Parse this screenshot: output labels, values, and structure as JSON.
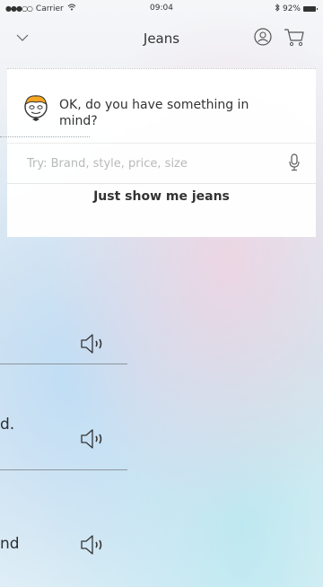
{
  "status_bar": {
    "signal": "●●●○○",
    "carrier": "Carrier",
    "time": "09:04",
    "battery_text": "92%"
  },
  "header": {
    "title": "Jeans",
    "back_icon": "chevron-down-icon",
    "profile_icon": "avatar-icon",
    "cart_icon": "cart-icon"
  },
  "chat": {
    "bot_message": "OK, do you have something in mind?",
    "search_placeholder": "Try: Brand, style, price, size",
    "just_show_label": "Just show me jeans"
  },
  "background_messages": [
    {
      "text": "",
      "icon": "speaker-icon"
    },
    {
      "text": "d.",
      "icon": "speaker-icon"
    },
    {
      "text": "nd",
      "icon": "speaker-icon"
    }
  ]
}
